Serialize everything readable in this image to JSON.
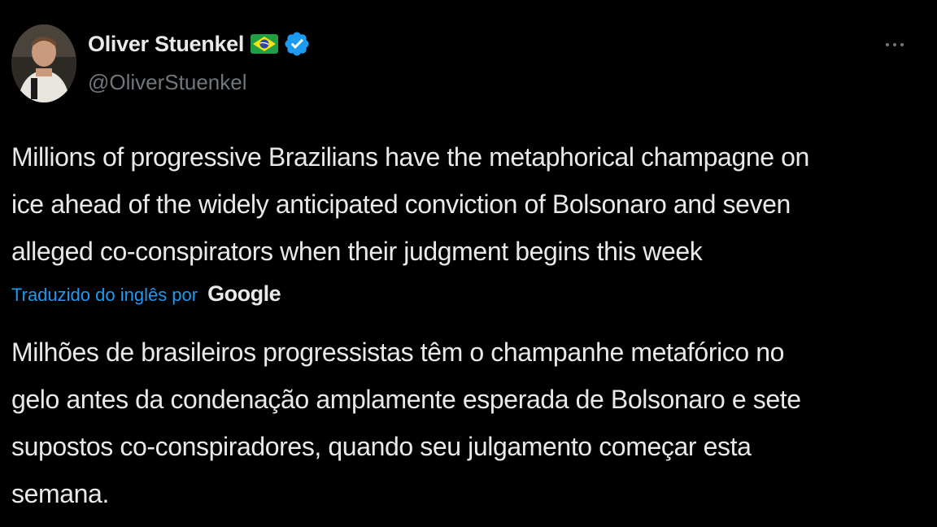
{
  "author": {
    "display_name": "Oliver Stuenkel",
    "handle": "@OliverStuenkel",
    "flag": "brazil-flag-icon",
    "verified": true
  },
  "tweet": {
    "text_lines": [
      "Millions of progressive Brazilians have the metaphorical champagne on",
      "ice ahead of the widely anticipated conviction of Bolsonaro and seven",
      "alleged co-conspirators when their judgment begins this week"
    ]
  },
  "translation": {
    "label": "Traduzido do inglês por",
    "provider": "Google",
    "text_lines": [
      "Milhões de brasileiros progressistas têm o champanhe metafórico no",
      "gelo antes da condenação amplamente esperada de Bolsonaro e sete",
      "supostos co-conspiradores, quando seu julgamento começar esta",
      "semana."
    ]
  },
  "colors": {
    "background": "#000000",
    "text": "#e7e9ea",
    "secondary": "#71767b",
    "link": "#1d9bf0",
    "verified": "#1d9bf0"
  }
}
